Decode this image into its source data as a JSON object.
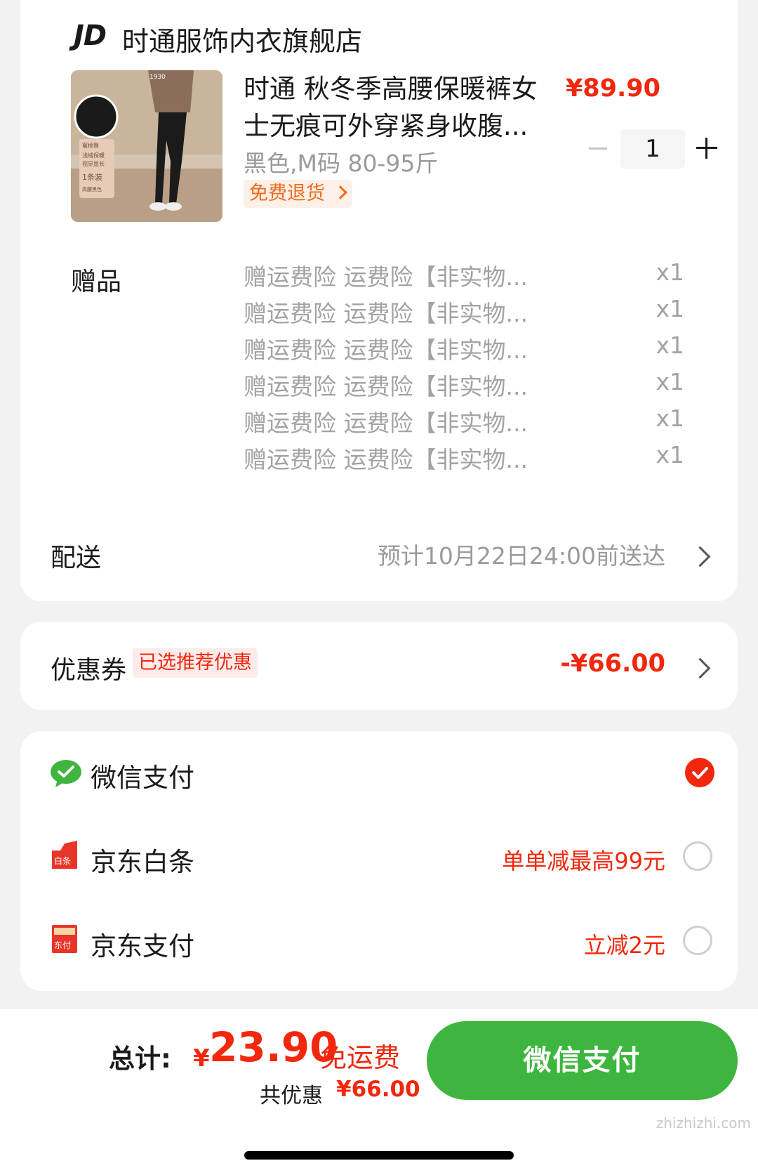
{
  "store": {
    "logo": "JD",
    "name": "时通服饰内衣旗舰店"
  },
  "product": {
    "title_line1": "时通 秋冬季高腰保暖裤女",
    "title_line2": "士无痕可外穿紧身收腹...",
    "spec": "黑色,M码 80-95斤",
    "free_return": "免费退货",
    "price": "¥89.90",
    "quantity": "1",
    "image_text_top": "1930",
    "image_badge_lines": [
      "蜜桃臀",
      "浅绒保暖",
      "视觉显长",
      "1条装",
      "高腰黑色"
    ]
  },
  "gifts": {
    "label": "赠品",
    "items": [
      {
        "name": "赠运费险 运费险【非实物...",
        "qty": "x1"
      },
      {
        "name": "赠运费险 运费险【非实物...",
        "qty": "x1"
      },
      {
        "name": "赠运费险 运费险【非实物...",
        "qty": "x1"
      },
      {
        "name": "赠运费险 运费险【非实物...",
        "qty": "x1"
      },
      {
        "name": "赠运费险 运费险【非实物...",
        "qty": "x1"
      },
      {
        "name": "赠运费险 运费险【非实物...",
        "qty": "x1"
      }
    ]
  },
  "delivery": {
    "label": "配送",
    "text": "预计10月22日24:00前送达"
  },
  "coupon": {
    "label": "优惠券",
    "tag": "已选推荐优惠",
    "amount": "-¥66.00"
  },
  "payment": {
    "options": [
      {
        "name": "微信支付",
        "promo": "",
        "selected": true,
        "icon": "wechat-pay-icon"
      },
      {
        "name": "京东白条",
        "promo": "单单减最高99元",
        "selected": false,
        "icon": "jd-baitiao-icon",
        "icon_text": "白条"
      },
      {
        "name": "京东支付",
        "promo": "立减2元",
        "selected": false,
        "icon": "jd-pay-icon",
        "icon_text": "东付"
      }
    ]
  },
  "summary": {
    "total_label": "总计:",
    "currency": "¥",
    "total": "23.90",
    "free_shipping": "免运费",
    "saved_label": "共优惠",
    "saved_amount": "¥66.00",
    "pay_button": "微信支付"
  },
  "watermark": "zhizhizhi.com",
  "colors": {
    "accent_red": "#f2270c",
    "wechat_green": "#3eb53e",
    "return_orange": "#f06a1a"
  }
}
